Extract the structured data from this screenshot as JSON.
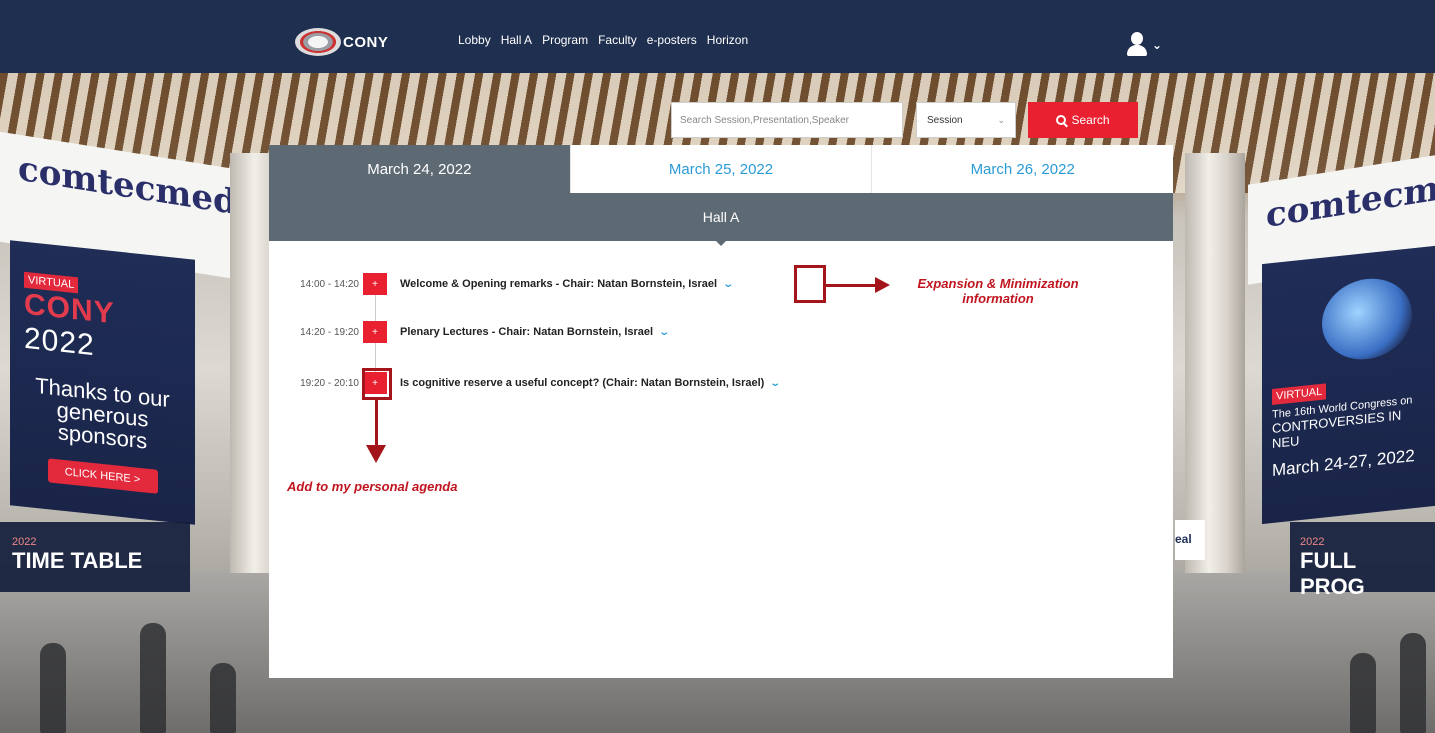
{
  "nav": {
    "logo_text": "CONY",
    "links": [
      "Lobby",
      "Hall A",
      "Program",
      "Faculty",
      "e-posters",
      "Horizon"
    ],
    "user_chevron": "⌄"
  },
  "search": {
    "placeholder": "Search Session,Presentation,Speaker",
    "type_value": "Session",
    "button_label": "Search"
  },
  "tabs": [
    "March 24, 2022",
    "March 25, 2022",
    "March 26, 2022"
  ],
  "active_tab": "March 24, 2022",
  "hall": "Hall A",
  "sessions": [
    {
      "time": "14:00 - 14:20",
      "title": "Welcome & Opening remarks - Chair: Natan Bornstein, Israel"
    },
    {
      "time": "14:20 - 19:20",
      "title": "Plenary Lectures - Chair: Natan Bornstein, Israel"
    },
    {
      "time": "19:20 - 20:10",
      "title": "Is cognitive reserve a useful concept? (Chair: Natan Bornstein, Israel)"
    }
  ],
  "plus_symbol": "+",
  "annotations": {
    "expansion_line1": "Expansion & Minimization",
    "expansion_line2": "information",
    "agenda": "Add to my personal agenda"
  },
  "background": {
    "comtec": "comtecmed",
    "virtual": "VIRTUAL",
    "cony_year": "2022",
    "thanks": "Thanks to our generous sponsors",
    "click_here": "CLICK HERE >",
    "time_table": "TIME TABLE",
    "full_program": "FULL PROG",
    "congress": "The 16th World Congress on",
    "controversies": "CONTROVERSIES IN NEU",
    "dates": "March 24-27, 2022",
    "seal": "eal"
  },
  "colors": {
    "nav_bg": "#1f2f4f",
    "accent_red": "#e8202f",
    "tab_active": "#5d6973",
    "link_blue": "#2a9bd6",
    "annotation": "#a3151a"
  }
}
